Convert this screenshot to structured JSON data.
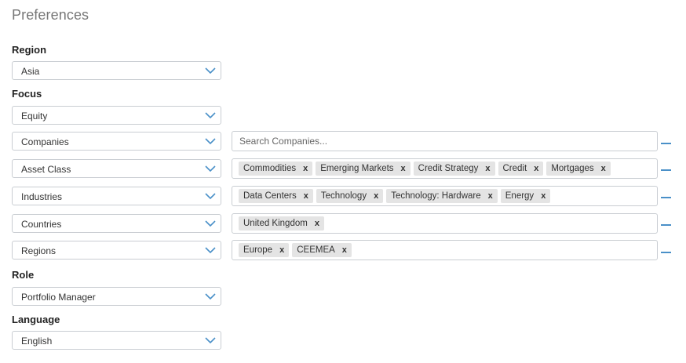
{
  "page_title": "Preferences",
  "sections": {
    "region": "Region",
    "focus": "Focus",
    "role": "Role",
    "language": "Language"
  },
  "selects": {
    "region": "Asia",
    "focus": "Equity",
    "role": "Portfolio Manager",
    "language": "English"
  },
  "filters": [
    {
      "type": "Companies",
      "placeholder": "Search Companies...",
      "tags": []
    },
    {
      "type": "Asset Class",
      "placeholder": "",
      "tags": [
        "Commodities",
        "Emerging Markets",
        "Credit Strategy",
        "Credit",
        "Mortgages"
      ]
    },
    {
      "type": "Industries",
      "placeholder": "",
      "tags": [
        "Data Centers",
        "Technology",
        "Technology: Hardware",
        "Energy"
      ]
    },
    {
      "type": "Countries",
      "placeholder": "",
      "tags": [
        "United Kingdom"
      ]
    },
    {
      "type": "Regions",
      "placeholder": "",
      "tags": [
        "Europe",
        "CEEMEA"
      ]
    }
  ],
  "icons": {
    "dropdown": "chevron-down-icon",
    "tag_remove": "close-icon",
    "row_remove": "minus-icon"
  },
  "colors": {
    "accent": "#4a90c8",
    "tag_bg": "#e4e4e4",
    "border": "#c9cdd2"
  },
  "tag_remove_glyph": "x"
}
